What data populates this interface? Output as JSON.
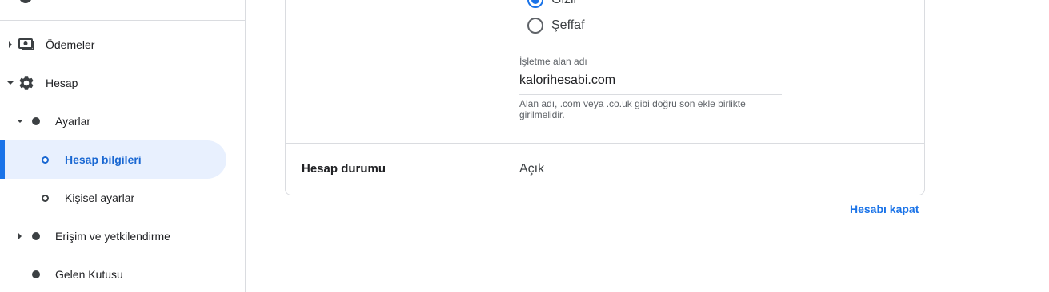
{
  "sidebar": {
    "items": [
      {
        "label": "Ödemeler",
        "icon": "payments-icon"
      },
      {
        "label": "Hesap",
        "icon": "gear-icon"
      },
      {
        "label": "Ayarlar"
      },
      {
        "label": "Hesap bilgileri"
      },
      {
        "label": "Kişisel ayarlar"
      },
      {
        "label": "Erişim ve yetkilendirme"
      },
      {
        "label": "Gelen Kutusu"
      }
    ]
  },
  "main": {
    "radio_options": [
      {
        "label": "Gizli",
        "checked": true
      },
      {
        "label": "Şeffaf",
        "checked": false
      }
    ],
    "domain_field": {
      "label": "İşletme alan adı",
      "value": "kalorihesabi.com",
      "help_line1": "Alan adı, .com veya .co.uk gibi doğru son ekle birlikte",
      "help_line2": "girilmelidir."
    },
    "account_status": {
      "label": "Hesap durumu",
      "value": "Açık"
    },
    "close_account_link": "Hesabı kapat"
  },
  "colors": {
    "accent": "#1a73e8",
    "active_bg": "#e8f0fe",
    "divider": "#dadce0"
  }
}
